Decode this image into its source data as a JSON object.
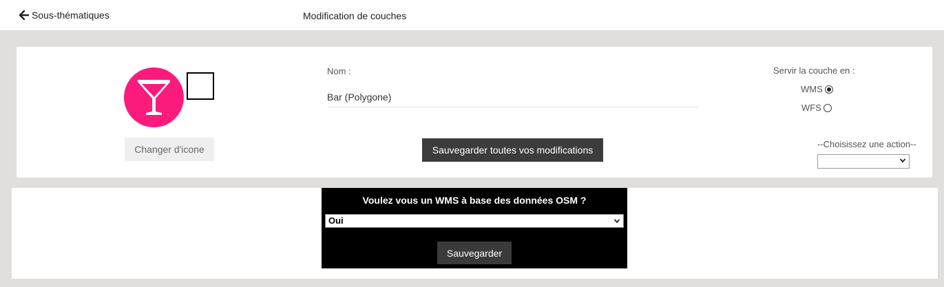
{
  "header": {
    "back_label": "Sous-thématiques",
    "title": "Modification de couches"
  },
  "layer": {
    "icon": "cocktail-glass-icon",
    "icon_bg_color": "#fb1b7d",
    "change_icon_label": "Changer d'icone",
    "name_label": "Nom :",
    "name_value": "Bar (Polygone)",
    "save_all_label": "Sauvegarder toutes vos modifications"
  },
  "serve": {
    "label": "Servir la couche en :",
    "options": [
      {
        "label": "WMS",
        "checked": true
      },
      {
        "label": "WFS",
        "checked": false
      }
    ]
  },
  "action": {
    "label": "--Choisissez une action--",
    "selected": ""
  },
  "osm": {
    "question": "Voulez vous un WMS à base des données OSM ?",
    "selected": "Oui",
    "save_label": "Sauvegarder"
  }
}
